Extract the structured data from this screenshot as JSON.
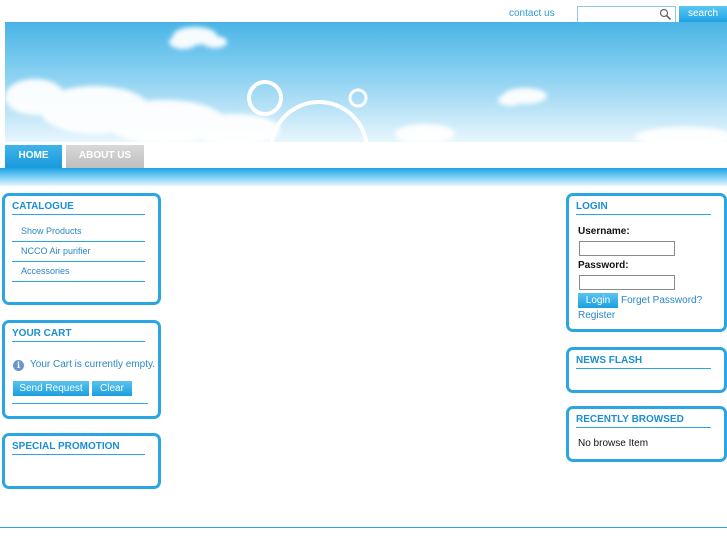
{
  "topbar": {
    "contact": "contact us",
    "search_placeholder": "",
    "search_button": "search"
  },
  "nav": {
    "tabs": [
      {
        "label": "HOME",
        "active": true
      },
      {
        "label": "ABOUT US",
        "active": false
      }
    ]
  },
  "catalogue": {
    "title": "CATALOGUE",
    "items": [
      {
        "label": "Show Products"
      },
      {
        "label": "NCCO Air purifier"
      },
      {
        "label": "Accessories"
      }
    ]
  },
  "cart": {
    "title": "YOUR CART",
    "message": "Your Cart is currently empty.",
    "send_button": "Send Request",
    "clear_button": "Clear"
  },
  "promotion": {
    "title": "SPECIAL PROMOTION"
  },
  "login": {
    "title": "LOGIN",
    "username_label": "Username:",
    "password_label": "Password:",
    "login_button": "Login",
    "forget_link": "Forget Password?",
    "register_link": "Register"
  },
  "newsflash": {
    "title": "NEWS FLASH"
  },
  "recent": {
    "title": "RECENTLY BROWSED",
    "message": "No browse Item"
  },
  "colors": {
    "accent": "#2ba6e4",
    "link": "#2a86c6",
    "title": "#1a8fd2"
  }
}
